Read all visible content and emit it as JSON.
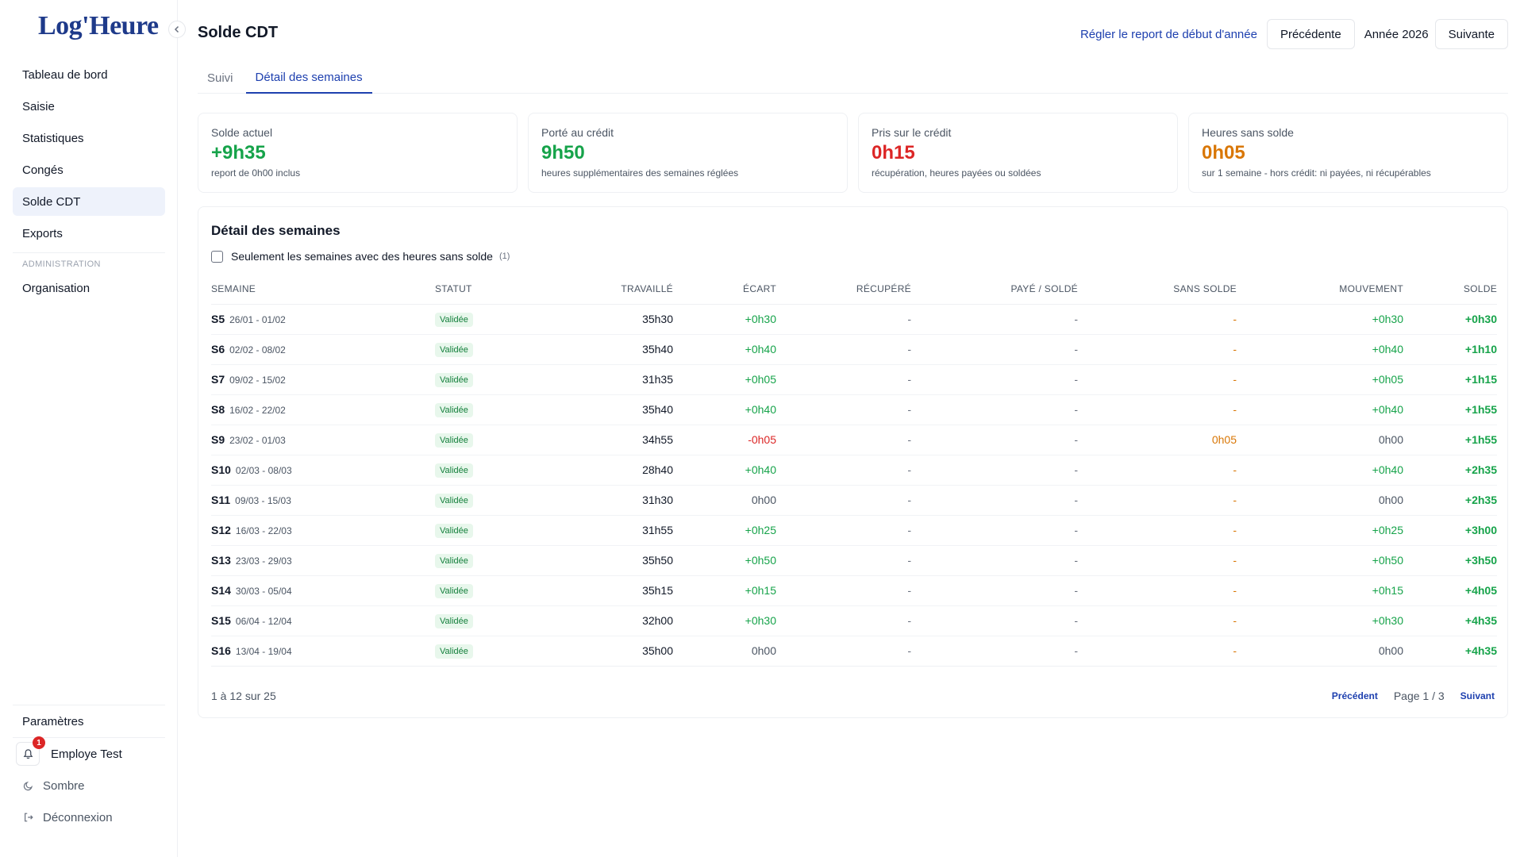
{
  "app": {
    "logo": "Log'Heure",
    "collapse_icon": "chevron-left-icon"
  },
  "sidebar": {
    "items": [
      {
        "label": "Tableau de bord"
      },
      {
        "label": "Saisie"
      },
      {
        "label": "Statistiques"
      },
      {
        "label": "Congés"
      },
      {
        "label": "Solde CDT",
        "active": true
      },
      {
        "label": "Exports"
      }
    ],
    "admin_section": "ADMINISTRATION",
    "admin_items": [
      {
        "label": "Organisation"
      }
    ],
    "settings": "Paramètres",
    "user": {
      "name": "Employe Test",
      "notifications": "1"
    },
    "theme": "Sombre",
    "logout": "Déconnexion"
  },
  "header": {
    "title": "Solde CDT",
    "adjust_link": "Régler le report de début d'année",
    "prev_label": "Précédente",
    "year": "Année 2026",
    "next_label": "Suivante"
  },
  "tabs": [
    {
      "label": "Suivi",
      "active": false
    },
    {
      "label": "Détail des semaines",
      "active": true
    }
  ],
  "cards": [
    {
      "label": "Solde actuel",
      "value": "+9h35",
      "sub": "report de 0h00 inclus",
      "color": "#16a34a"
    },
    {
      "label": "Porté au crédit",
      "value": "9h50",
      "sub": "heures supplémentaires des semaines réglées",
      "color": "#16a34a"
    },
    {
      "label": "Pris sur le crédit",
      "value": "0h15",
      "sub": "récupération, heures payées ou soldées",
      "color": "#dc2626"
    },
    {
      "label": "Heures sans solde",
      "value": "0h05",
      "sub": "sur 1 semaine - hors crédit: ni payées, ni récupérables",
      "color": "#d97706"
    }
  ],
  "detail": {
    "title": "Détail des semaines",
    "filter_label": "Seulement les semaines avec des heures sans solde",
    "filter_count": "(1)",
    "columns": [
      "SEMAINE",
      "STATUT",
      "TRAVAILLÉ",
      "ÉCART",
      "RÉCUPÉRÉ",
      "PAYÉ / SOLDÉ",
      "SANS SOLDE",
      "MOUVEMENT",
      "SOLDE"
    ],
    "rows": [
      {
        "week": "S5",
        "range": "26/01 - 01/02",
        "status": "Validée",
        "worked": "35h30",
        "gap": "+0h30",
        "recovered": "-",
        "paid": "-",
        "unpaid": "-",
        "movement": "+0h30",
        "balance": "+0h30"
      },
      {
        "week": "S6",
        "range": "02/02 - 08/02",
        "status": "Validée",
        "worked": "35h40",
        "gap": "+0h40",
        "recovered": "-",
        "paid": "-",
        "unpaid": "-",
        "movement": "+0h40",
        "balance": "+1h10"
      },
      {
        "week": "S7",
        "range": "09/02 - 15/02",
        "status": "Validée",
        "worked": "31h35",
        "gap": "+0h05",
        "recovered": "-",
        "paid": "-",
        "unpaid": "-",
        "movement": "+0h05",
        "balance": "+1h15"
      },
      {
        "week": "S8",
        "range": "16/02 - 22/02",
        "status": "Validée",
        "worked": "35h40",
        "gap": "+0h40",
        "recovered": "-",
        "paid": "-",
        "unpaid": "-",
        "movement": "+0h40",
        "balance": "+1h55"
      },
      {
        "week": "S9",
        "range": "23/02 - 01/03",
        "status": "Validée",
        "worked": "34h55",
        "gap": "-0h05",
        "recovered": "-",
        "paid": "-",
        "unpaid": "0h05",
        "movement": "0h00",
        "balance": "+1h55"
      },
      {
        "week": "S10",
        "range": "02/03 - 08/03",
        "status": "Validée",
        "worked": "28h40",
        "gap": "+0h40",
        "recovered": "-",
        "paid": "-",
        "unpaid": "-",
        "movement": "+0h40",
        "balance": "+2h35"
      },
      {
        "week": "S11",
        "range": "09/03 - 15/03",
        "status": "Validée",
        "worked": "31h30",
        "gap": "0h00",
        "recovered": "-",
        "paid": "-",
        "unpaid": "-",
        "movement": "0h00",
        "balance": "+2h35"
      },
      {
        "week": "S12",
        "range": "16/03 - 22/03",
        "status": "Validée",
        "worked": "31h55",
        "gap": "+0h25",
        "recovered": "-",
        "paid": "-",
        "unpaid": "-",
        "movement": "+0h25",
        "balance": "+3h00"
      },
      {
        "week": "S13",
        "range": "23/03 - 29/03",
        "status": "Validée",
        "worked": "35h50",
        "gap": "+0h50",
        "recovered": "-",
        "paid": "-",
        "unpaid": "-",
        "movement": "+0h50",
        "balance": "+3h50"
      },
      {
        "week": "S14",
        "range": "30/03 - 05/04",
        "status": "Validée",
        "worked": "35h15",
        "gap": "+0h15",
        "recovered": "-",
        "paid": "-",
        "unpaid": "-",
        "movement": "+0h15",
        "balance": "+4h05"
      },
      {
        "week": "S15",
        "range": "06/04 - 12/04",
        "status": "Validée",
        "worked": "32h00",
        "gap": "+0h30",
        "recovered": "-",
        "paid": "-",
        "unpaid": "-",
        "movement": "+0h30",
        "balance": "+4h35"
      },
      {
        "week": "S16",
        "range": "13/04 - 19/04",
        "status": "Validée",
        "worked": "35h00",
        "gap": "0h00",
        "recovered": "-",
        "paid": "-",
        "unpaid": "-",
        "movement": "0h00",
        "balance": "+4h35"
      }
    ],
    "pagination": {
      "summary": "1 à 12 sur 25",
      "prev": "Précédent",
      "page": "Page 1 / 3",
      "next": "Suivant"
    }
  },
  "colors": {
    "accent": "#1e40af",
    "positive": "#16a34a",
    "negative": "#dc2626",
    "unpaid": "#d97706"
  }
}
